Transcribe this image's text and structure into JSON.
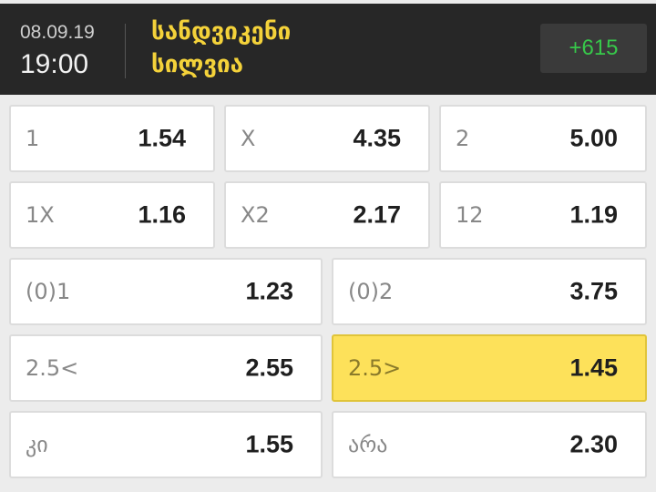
{
  "match": {
    "date": "08.09.19",
    "time": "19:00",
    "team1": "სანდვიკენი",
    "team2": "სილვია",
    "more_markets": "+615"
  },
  "rows": [
    [
      {
        "label": "1",
        "odd": "1.54"
      },
      {
        "label": "X",
        "odd": "4.35"
      },
      {
        "label": "2",
        "odd": "5.00"
      }
    ],
    [
      {
        "label": "1X",
        "odd": "1.16"
      },
      {
        "label": "X2",
        "odd": "2.17"
      },
      {
        "label": "12",
        "odd": "1.19"
      }
    ],
    [
      {
        "label": "(0)1",
        "odd": "1.23"
      },
      {
        "label": "(0)2",
        "odd": "3.75"
      }
    ],
    [
      {
        "label": "2.5<",
        "odd": "2.55"
      },
      {
        "label": "2.5>",
        "odd": "1.45",
        "selected": true
      }
    ],
    [
      {
        "label": "კი",
        "odd": "1.55"
      },
      {
        "label": "არა",
        "odd": "2.30"
      }
    ]
  ],
  "colors": {
    "header_bg": "#272727",
    "team_text": "#f4d23a",
    "more_text": "#37c84a",
    "selected_bg": "#fde15a"
  }
}
